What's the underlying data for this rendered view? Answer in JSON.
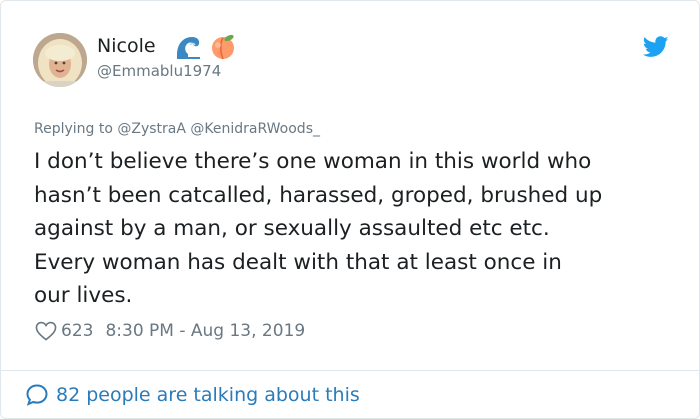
{
  "tweet": {
    "author_name": "Nicole",
    "author_handle": "@Emmablu1974",
    "name_emojis": [
      "wave-emoji",
      "peach-emoji"
    ],
    "reply_prefix": "Replying to ",
    "reply_mentions": "@ZystraA @KenidraRWoods_",
    "text": "I don’t believe there’s one woman in this world who\nhasn’t been catcalled, harassed, groped, brushed up\nagainst by a man, or sexually assaulted etc etc.\nEvery woman has dealt with that at least once in\nour lives.",
    "likes": "623",
    "timestamp": "8:30 PM - Aug 13, 2019",
    "conversation_label": "82 people are talking about this"
  },
  "colors": {
    "text": "#1c2022",
    "muted": "#697882",
    "link": "#2b7bb9",
    "twitter_blue": "#1da1f2"
  }
}
